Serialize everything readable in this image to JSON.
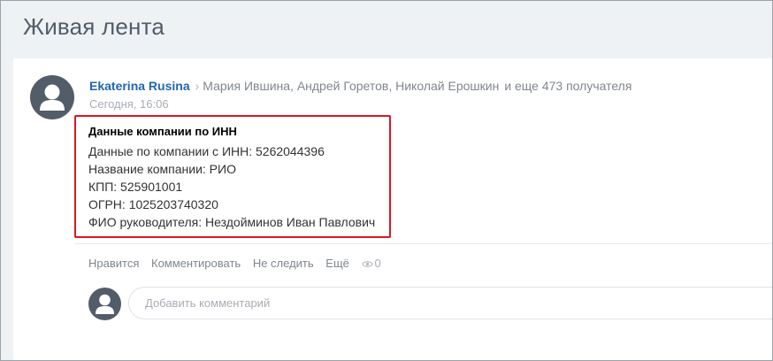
{
  "page": {
    "title": "Живая лента"
  },
  "post": {
    "author": "Ekaterina Rusina",
    "recipients": "Мария Ившина, Андрей Горетов, Николай Ерошкин",
    "more_recipients": "и еще 473 получателя",
    "date": "Сегодня, 16:06",
    "info": {
      "title": "Данные компании по ИНН",
      "lines": [
        "Данные по компании с ИНН: 5262044396",
        "Название компании: РИО",
        "КПП: 525901001",
        "ОГРН: 1025203740320",
        "ФИО руководителя: Нездойминов Иван Павлович"
      ]
    },
    "actions": {
      "like": "Нравится",
      "comment": "Комментировать",
      "unfollow": "Не следить",
      "more": "Ещё",
      "views": "0"
    }
  },
  "comment": {
    "placeholder": "Добавить комментарий"
  },
  "colors": {
    "accent": "#2067b0",
    "highlight_border": "#d61a22",
    "avatar": "#535c69"
  }
}
